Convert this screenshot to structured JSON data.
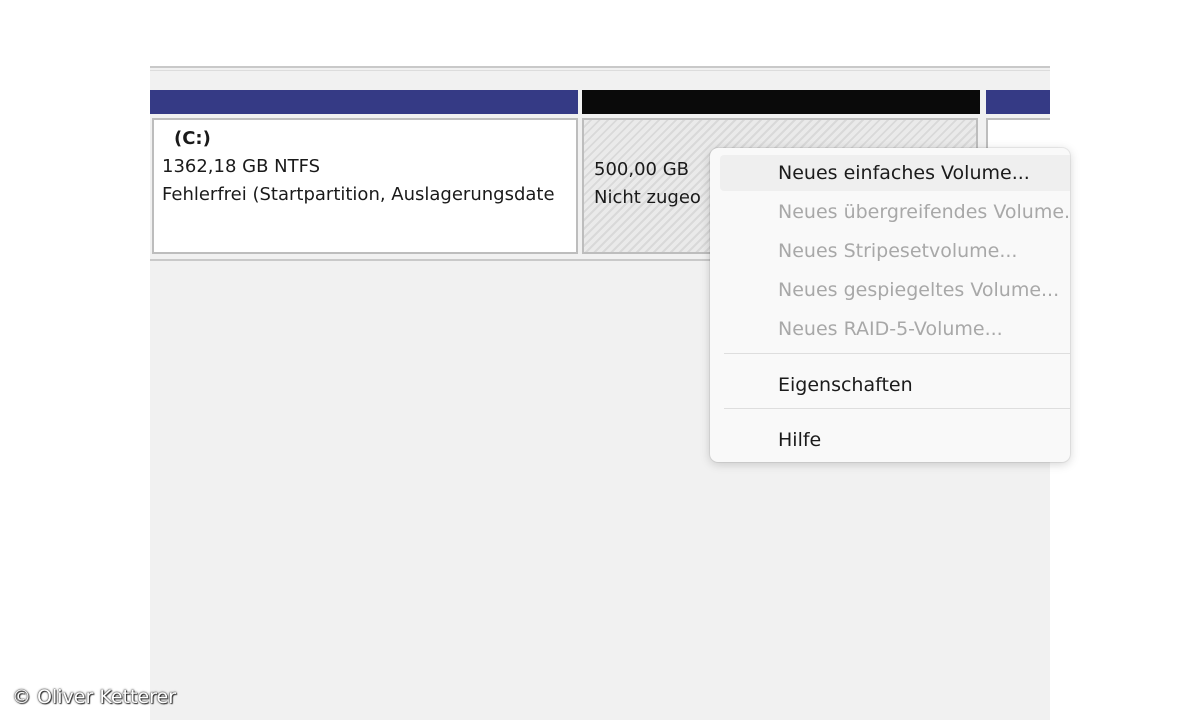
{
  "partitions": [
    {
      "title": "(C:)",
      "size": "1362,18 GB NTFS",
      "status": "Fehlerfrei (Startpartition, Auslagerungsdate",
      "color": "#353a85"
    },
    {
      "size": "500,00 GB",
      "status": "Nicht zugeo",
      "color": "#0a0a0a"
    },
    {
      "color": "#353a85"
    }
  ],
  "context_menu": {
    "items": [
      {
        "label": "Neues einfaches Volume...",
        "enabled": true
      },
      {
        "label": "Neues übergreifendes Volume...",
        "enabled": false
      },
      {
        "label": "Neues Stripesetvolume...",
        "enabled": false
      },
      {
        "label": "Neues gespiegeltes Volume...",
        "enabled": false
      },
      {
        "label": "Neues RAID-5-Volume...",
        "enabled": false
      },
      {
        "label": "Eigenschaften",
        "enabled": true
      },
      {
        "label": "Hilfe",
        "enabled": true
      }
    ]
  },
  "copyright": "© Oliver Ketterer"
}
